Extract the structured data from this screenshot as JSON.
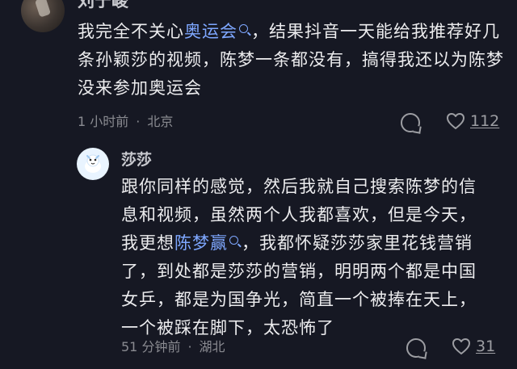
{
  "comment1": {
    "author": "刘宁峻",
    "text_before_link": "我完全不关心",
    "link_text": "奥运会",
    "text_after_link": "，结果抖音一天能给我推荐好几条孙颖莎的视频，陈梦一条都没有，搞得我还以为陈梦没来参加奥运会",
    "time": "1 小时前",
    "location": "北京",
    "like_count": "112"
  },
  "comment2": {
    "author": "莎莎",
    "text_before_link": "跟你同样的感觉，然后我就自己搜索陈梦的信息和视频，虽然两个人我都喜欢，但是今天，我更想",
    "link_text": "陈梦赢",
    "text_after_link": "，我都怀疑莎莎家里花钱营销了，到处都是莎莎的营销，明明两个都是中国女乒，都是为国争光，简直一个被捧在天上，一个被踩在脚下，太恐怖了",
    "time": "51 分钟前",
    "location": "湖北",
    "like_count": "31"
  },
  "colors": {
    "background": "#161823",
    "link": "#7ea7ff",
    "meta": "#8a8b91"
  },
  "icons": [
    "reply-icon",
    "heart-icon",
    "search-icon",
    "avatar"
  ]
}
